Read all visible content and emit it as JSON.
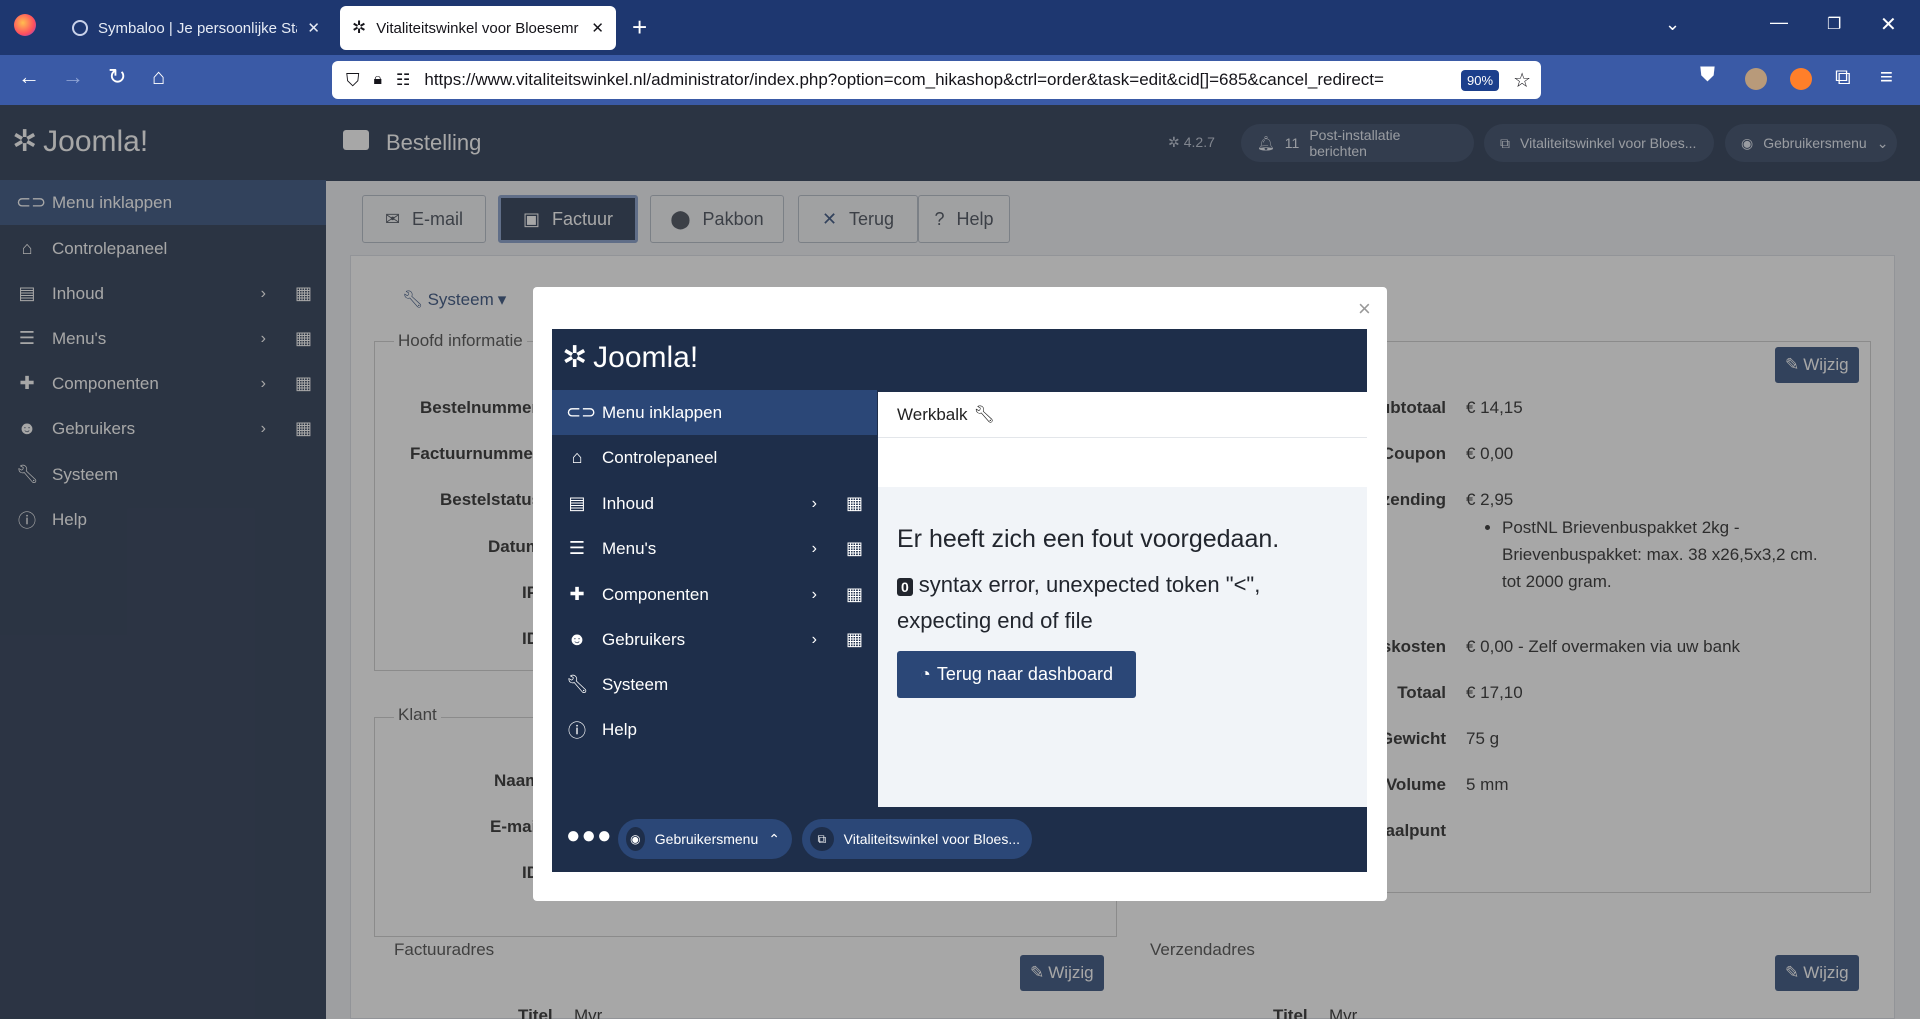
{
  "browser": {
    "tabs": [
      {
        "label": "Symbaloo | Je persoonlijke Start"
      },
      {
        "label": "Vitaliteitswinkel voor Bloesemr"
      }
    ],
    "url": "https://www.vitaliteitswinkel.nl/administrator/index.php?option=com_hikashop&ctrl=order&task=edit&cid[]=685&cancel_redirect=",
    "zoom": "90%"
  },
  "joomla": {
    "logo": "Joomla!",
    "page_title": "Bestelling",
    "version": "4.2.7",
    "notifications": {
      "count": "11",
      "label": "Post-installatie berichten"
    },
    "site_link": "Vitaliteitswinkel voor Bloes...",
    "user_menu": "Gebruikersmenu",
    "sidebar": [
      {
        "label": "Menu inklappen"
      },
      {
        "label": "Controlepaneel"
      },
      {
        "label": "Inhoud"
      },
      {
        "label": "Menu's"
      },
      {
        "label": "Componenten"
      },
      {
        "label": "Gebruikers"
      },
      {
        "label": "Systeem"
      },
      {
        "label": "Help"
      }
    ],
    "toolbar": {
      "email": "E-mail",
      "factuur": "Factuur",
      "pakbon": "Pakbon",
      "terug": "Terug",
      "help": "Help"
    },
    "systeem_dropdown": "Systeem",
    "sections": {
      "hoofd": "Hoofd informatie",
      "klant": "Klant",
      "factuuradres": "Factuuradres",
      "verzendadres": "Verzendadres"
    },
    "left_fields": [
      "Bestelnummer",
      "Factuurnummer",
      "Bestelstatus",
      "Datum",
      "IP",
      "ID"
    ],
    "klant_fields": [
      "Naam",
      "E-mail",
      "ID"
    ],
    "adres_label": "Titel",
    "adres_value": "Mvr",
    "wijzig": "Wijzig",
    "totals": [
      {
        "label": "Subtotaal",
        "value": "€ 14,15"
      },
      {
        "label": "Coupon",
        "value": "€ 0,00"
      },
      {
        "label": "Verzending",
        "value": "€ 2,95",
        "details": [
          "PostNL Brievenbuspakket 2kg -",
          "Brievenbuspakket: max. 38 x26,5x3,2 cm.",
          "tot 2000 gram."
        ]
      },
      {
        "label": "Betalingskosten",
        "value": "€ 0,00 - Zelf overmaken via uw bank"
      },
      {
        "label": "Totaal",
        "value": "€ 17,10"
      },
      {
        "label": "Gewicht",
        "value": "75 g"
      },
      {
        "label": "Volume",
        "value": "5 mm"
      },
      {
        "label": "Afhaalpunt",
        "value": ""
      }
    ]
  },
  "modal": {
    "close": "×",
    "werkbalk": "Werkbalk",
    "error_title": "Er heeft zich een fout voorgedaan.",
    "error_code": "0",
    "error_msg_line1": "syntax error, unexpected token \"<\",",
    "error_msg_line2": "expecting end of file",
    "button": "Terug naar dashboard",
    "user_menu": "Gebruikersmenu",
    "site_link": "Vitaliteitswinkel voor Bloes..."
  },
  "colors": {
    "sidebar": "#1e2e4a",
    "accent": "#2b4777",
    "browser": "#1e3770"
  }
}
